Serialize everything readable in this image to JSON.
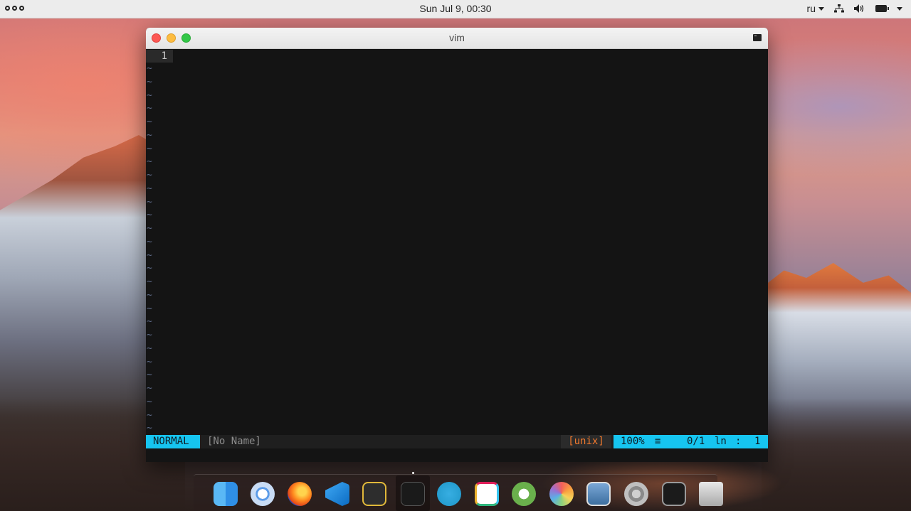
{
  "menubar": {
    "clock": "Sun Jul  9, 00:30",
    "language": "ru",
    "icons": [
      "network-icon",
      "volume-icon",
      "battery-icon"
    ]
  },
  "window": {
    "title": "vim",
    "colors": {
      "close": "#fc5753",
      "minimize": "#fdbc40",
      "maximize": "#33c748"
    }
  },
  "vim": {
    "line_number": "1",
    "tilde": "~",
    "tilde_count": 28,
    "status": {
      "mode": "NORMAL",
      "filename": "[No Name]",
      "fileformat": "[unix]",
      "percent": "100%",
      "bars": "≡",
      "count": "0/1",
      "ln": "ln",
      "colon": ":",
      "col": "1"
    },
    "colors": {
      "accent": "#16c5f0",
      "fileformat": "#f0792e",
      "tilde": "#5e6c8a"
    }
  },
  "dock": {
    "items": [
      {
        "name": "finder-icon"
      },
      {
        "name": "chromium-icon"
      },
      {
        "name": "firefox-icon"
      },
      {
        "name": "vscode-icon"
      },
      {
        "name": "code-editor-icon"
      },
      {
        "name": "terminal-icon",
        "active": true
      },
      {
        "name": "telegram-icon"
      },
      {
        "name": "slack-icon"
      },
      {
        "name": "keys-icon"
      },
      {
        "name": "photos-icon"
      },
      {
        "name": "image-viewer-icon"
      },
      {
        "name": "system-preferences-icon"
      },
      {
        "name": "activity-monitor-icon"
      },
      {
        "name": "disk-drive-icon"
      }
    ]
  }
}
